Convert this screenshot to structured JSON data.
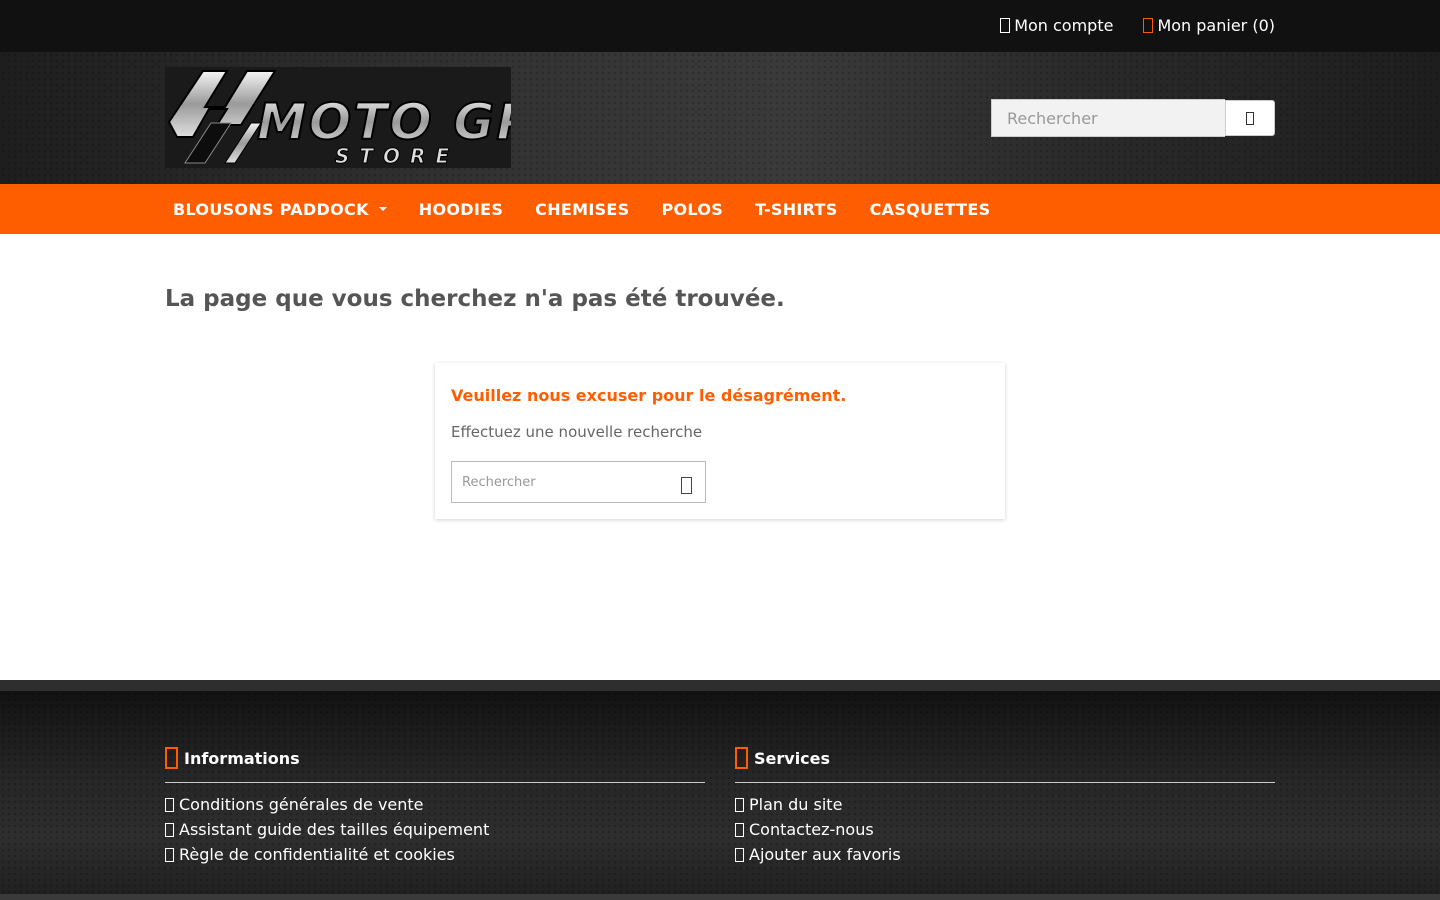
{
  "topbar": {
    "account": {
      "label": "Mon compte",
      "icon": "user-icon"
    },
    "cart": {
      "label": "Mon panier (0)",
      "icon": "cart-icon"
    }
  },
  "header": {
    "logo_alt": "MotoGP Store",
    "logo_text": "MOTO GP",
    "logo_subtext": "STORE",
    "search": {
      "placeholder": "Rechercher",
      "icon": "search-icon"
    }
  },
  "nav": {
    "items": [
      {
        "label": "BLOUSONS PADDOCK",
        "has_dropdown": true
      },
      {
        "label": "HOODIES"
      },
      {
        "label": "CHEMISES"
      },
      {
        "label": "POLOS"
      },
      {
        "label": "T-SHIRTS"
      },
      {
        "label": "CASQUETTES"
      }
    ]
  },
  "main": {
    "title": "La page que vous cherchez n'a pas été trouvée.",
    "card": {
      "apology": "Veuillez nous excuser pour le désagrément.",
      "retry_text": "Effectuez une nouvelle recherche",
      "search_placeholder": "Rechercher"
    }
  },
  "footer": {
    "informations": {
      "title": "Informations",
      "links": [
        "Conditions générales de vente",
        "Assistant guide des tailles équipement",
        "Règle de confidentialité et cookies"
      ]
    },
    "services": {
      "title": "Services",
      "links": [
        "Plan du site",
        "Contactez-nous",
        "Ajouter aux favoris"
      ]
    }
  },
  "colors": {
    "accent": "#ff5e00",
    "topbar": "#111111",
    "text": "#555555"
  }
}
